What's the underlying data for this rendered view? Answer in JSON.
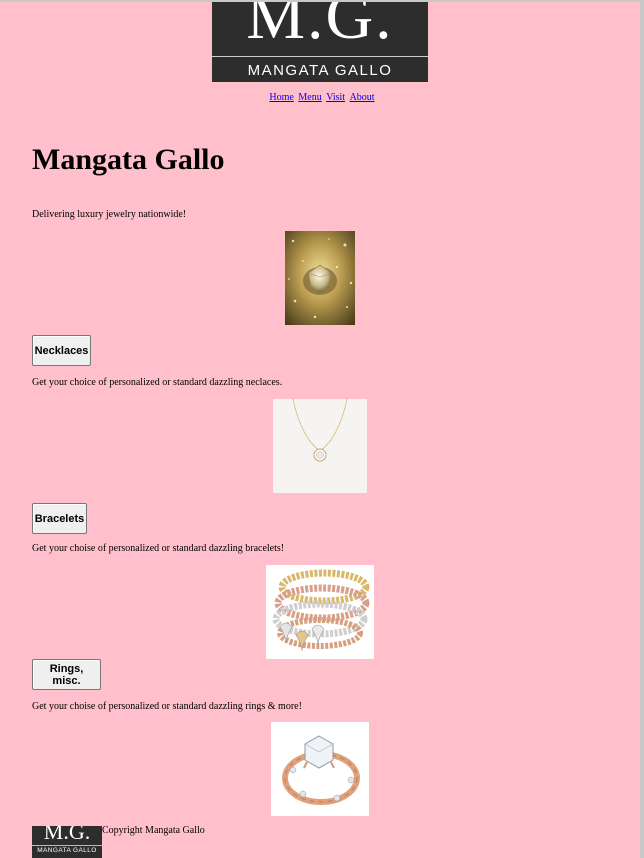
{
  "logo": {
    "monogram": "M.G.",
    "wordmark": "MANGATA GALLO"
  },
  "nav": {
    "home": "Home",
    "menu": "Menu",
    "visit": "Visit",
    "about": "About"
  },
  "hero": {
    "title": "Mangata Gallo",
    "tagline": "Delivering luxury jewelry nationwide!"
  },
  "sections": {
    "necklaces": {
      "button": "Necklaces",
      "text": "Get your choice of personalized or standard dazzling neclaces."
    },
    "bracelets": {
      "button": "Bracelets",
      "text": "Get your choise of personalized or standard dazzling bracelets!"
    },
    "rings": {
      "button": "Rings, misc.",
      "text": "Get your choise of personalized or standard dazzling rings & more!"
    }
  },
  "footer": {
    "monogram": "M.G.",
    "wordmark": "MANGATA GALLO",
    "copyright": "Copyright Mangata Gallo"
  },
  "colors": {
    "background": "#ffc0cb",
    "logo_bg": "#2e2d2d",
    "link": "#0000ee"
  }
}
